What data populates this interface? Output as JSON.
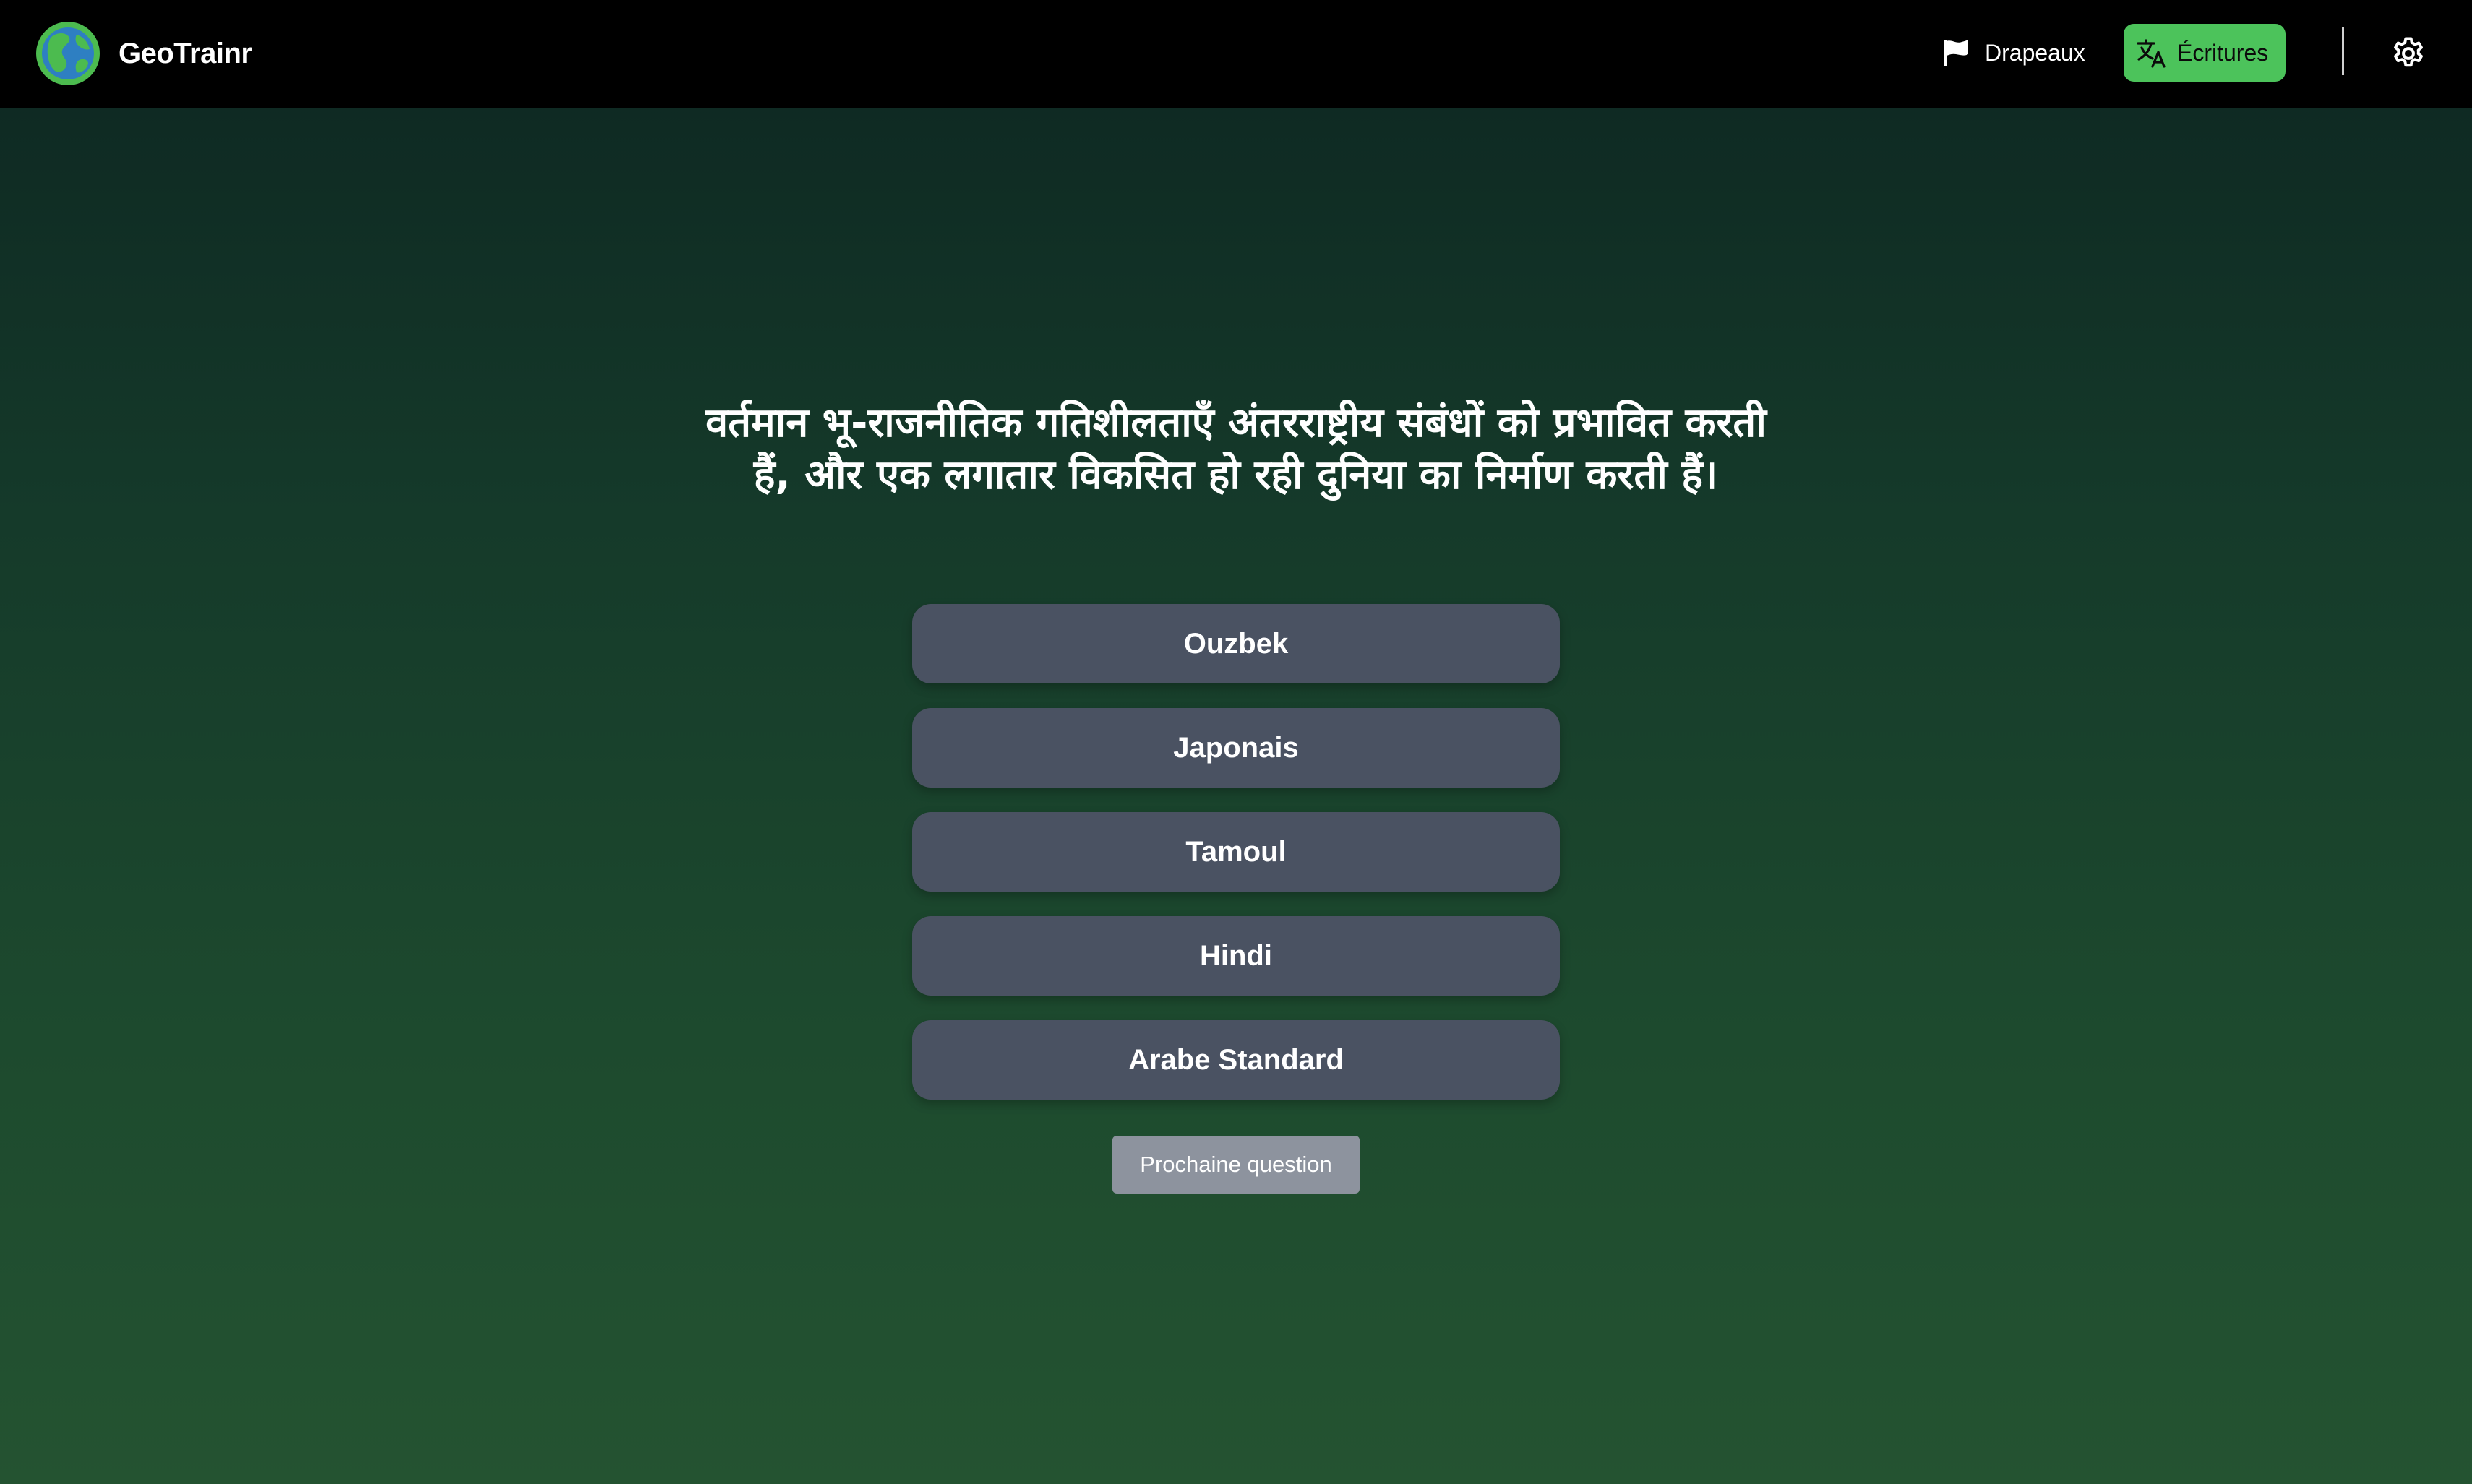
{
  "app": {
    "name": "GeoTrainr"
  },
  "nav": {
    "items": [
      {
        "label": "Drapeaux",
        "icon": "flag-icon",
        "active": false
      },
      {
        "label": "Écritures",
        "icon": "translate-icon",
        "active": true
      }
    ],
    "settings_icon": "gear-icon"
  },
  "quiz": {
    "question": "वर्तमान भू-राजनीतिक गतिशीलताएँ अंतरराष्ट्रीय संबंधों को प्रभावित करती हैं, और एक लगातार विकसित हो रही दुनिया का निर्माण करती हैं।",
    "answers": [
      {
        "label": "Ouzbek"
      },
      {
        "label": "Japonais"
      },
      {
        "label": "Tamoul"
      },
      {
        "label": "Hindi"
      },
      {
        "label": "Arabe Standard"
      }
    ],
    "next_label": "Prochaine question"
  },
  "colors": {
    "accent": "#4cc35b",
    "answer_bg": "#4a5262",
    "next_bg": "#8d939e",
    "navbar_bg": "#000000"
  }
}
